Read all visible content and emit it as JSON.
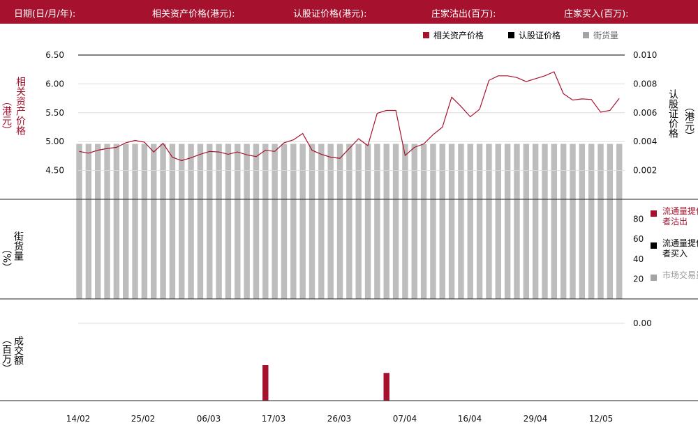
{
  "header": {
    "cols": [
      "日期(日/月/年):",
      "相关资产价格(港元):",
      "认股证价格(港元):",
      "庄家沽出(百万):",
      "庄家买入(百万):"
    ]
  },
  "colors": {
    "brand": "#a6122d",
    "underlying": "#a6122d",
    "warrant": "#000000",
    "bars": "#bdbdbd",
    "market": "#a3a3a3"
  },
  "legend_top": {
    "underlying": "相关资产价格",
    "warrant": "认股证价格",
    "street": "街货量"
  },
  "panel1": {
    "left_label": "相关资产价格",
    "left_unit": "港元",
    "right_label": "认股证价格",
    "right_unit": "港元"
  },
  "panel2": {
    "left_label": "街货量",
    "left_unit": "%",
    "legend": [
      "流通量提供者沽出",
      "流通量提供者买入",
      "市场交易量"
    ]
  },
  "panel3": {
    "left_label": "成交额",
    "left_unit": "百万"
  },
  "chart_data": {
    "type": "line",
    "x_labels": [
      "14/02",
      "25/02",
      "06/03",
      "17/03",
      "26/03",
      "07/04",
      "16/04",
      "29/04",
      "12/05"
    ],
    "left_axis": {
      "ticks": [
        "6.50",
        "6.00",
        "5.50",
        "5.00",
        "4.50"
      ],
      "ylim": [
        4.0,
        6.5
      ]
    },
    "right_axis": {
      "ticks": [
        "0.010",
        "0.008",
        "0.006",
        "0.004",
        "0.002"
      ],
      "ylim": [
        0.0,
        0.01
      ]
    },
    "series": [
      {
        "name": "相关资产价格",
        "values": [
          4.83,
          4.8,
          4.85,
          4.88,
          4.9,
          4.98,
          5.02,
          4.99,
          4.82,
          4.97,
          4.73,
          4.67,
          4.72,
          4.78,
          4.83,
          4.82,
          4.78,
          4.82,
          4.77,
          4.74,
          4.85,
          4.83,
          4.98,
          5.03,
          5.14,
          4.85,
          4.78,
          4.73,
          4.71,
          4.88,
          5.05,
          4.93,
          5.49,
          5.54,
          5.54,
          4.76,
          4.9,
          4.96,
          5.12,
          5.25,
          5.77,
          5.61,
          5.43,
          5.56,
          6.06,
          6.14,
          6.14,
          6.11,
          6.04,
          6.09,
          6.14,
          6.21,
          5.83,
          5.72,
          5.74,
          5.73,
          5.51,
          5.54,
          5.75
        ]
      }
    ],
    "street_bars": {
      "name": "街货量",
      "count": 59,
      "bar_height_value": 4.96
    },
    "volume_panel": {
      "ticks": [
        "80",
        "60",
        "40",
        "20"
      ],
      "ylim": [
        0,
        100
      ],
      "bar_value": 100,
      "count": 59
    },
    "turnover_panel": {
      "ticks": [
        "0.00"
      ],
      "bars": [
        {
          "index": 20,
          "value": 1.0
        },
        {
          "index": 33,
          "value": 0.78
        }
      ]
    }
  }
}
